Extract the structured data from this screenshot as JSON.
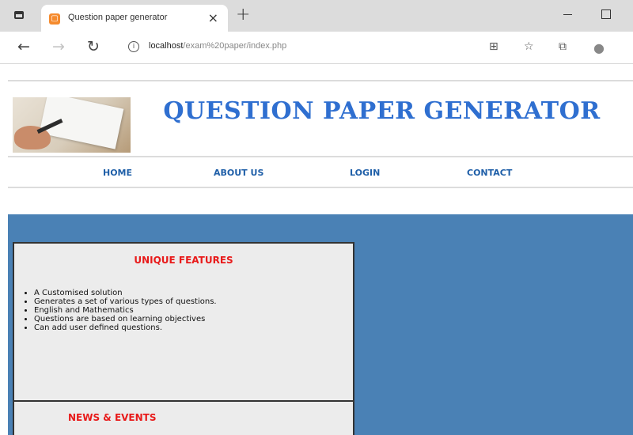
{
  "browser": {
    "tab_title": "Question paper generator",
    "tab_close": "×",
    "new_tab": "+",
    "url_host": "localhost",
    "url_path": "/exam%20paper/index.php"
  },
  "site": {
    "title": "QUESTION PAPER GENERATOR"
  },
  "nav": {
    "items": [
      {
        "label": "HOME"
      },
      {
        "label": "ABOUT US"
      },
      {
        "label": "LOGIN"
      },
      {
        "label": "CONTACT"
      }
    ]
  },
  "features": {
    "heading": "UNIQUE FEATURES",
    "items": [
      "A Customised solution",
      "Generates a set of various types of questions.",
      "English and Mathematics",
      "Questions are based on learning objectives",
      "Can add user defined questions."
    ]
  },
  "news": {
    "heading": "NEWS & EVENTS"
  },
  "colors": {
    "title_blue": "#2f6fd0",
    "nav_blue": "#1f5fa8",
    "heading_red": "#e81a1a",
    "background_blue": "#4a81b5"
  }
}
